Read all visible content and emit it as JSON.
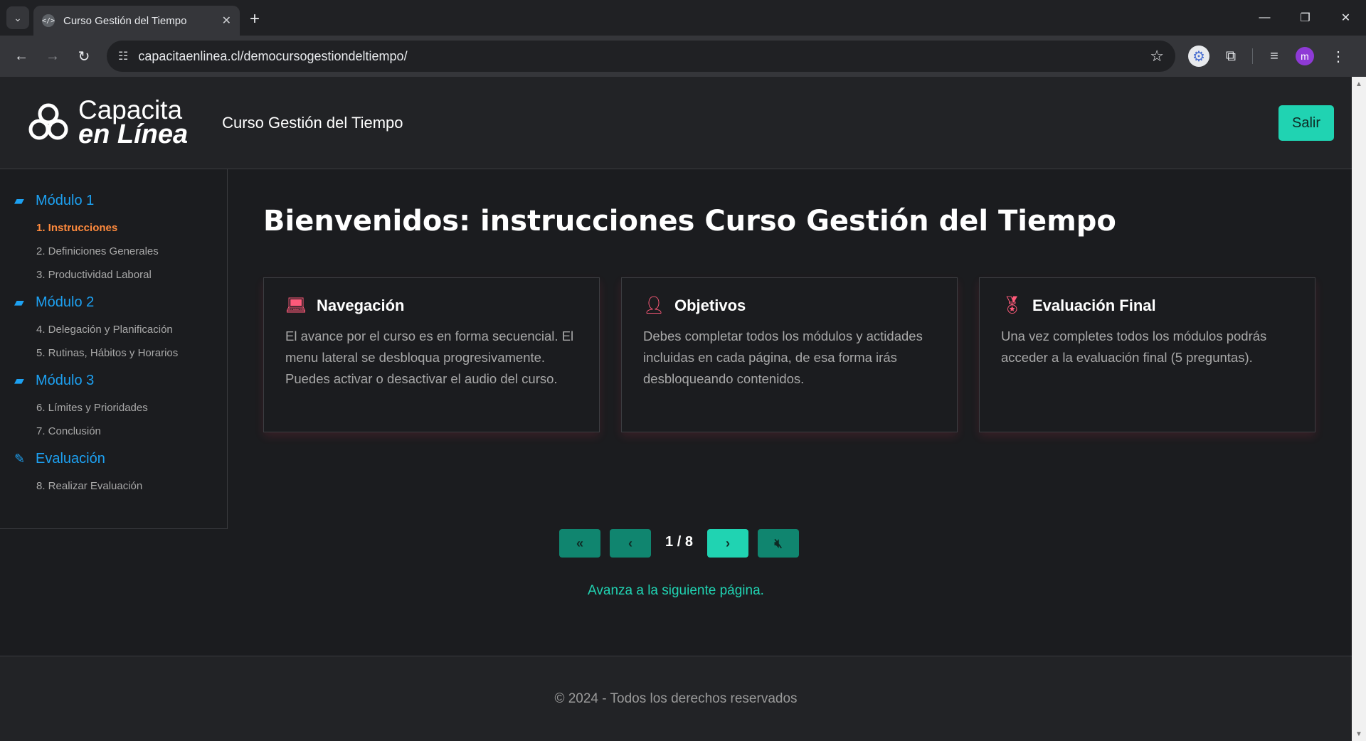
{
  "browser": {
    "tab_title": "Curso Gestión del Tiempo",
    "url": "capacitaenlinea.cl/democursogestiondeltiempo/",
    "profile_initial": "m"
  },
  "site": {
    "logo_line1": "Capacita",
    "logo_line2": "en Línea",
    "course_title": "Curso Gestión del Tiempo",
    "exit_label": "Salir"
  },
  "sidebar": {
    "modules": [
      {
        "label": "Módulo 1",
        "icon": "archive-icon",
        "lessons": [
          "1. Instrucciones",
          "2. Definiciones Generales",
          "3. Productividad Laboral"
        ]
      },
      {
        "label": "Módulo 2",
        "icon": "archive-icon",
        "lessons": [
          "4. Delegación y Planificación",
          "5. Rutinas, Hábitos y Horarios"
        ]
      },
      {
        "label": "Módulo 3",
        "icon": "archive-icon",
        "lessons": [
          "6. Límites y Prioridades",
          "7. Conclusión"
        ]
      },
      {
        "label": "Evaluación",
        "icon": "pen-icon",
        "lessons": [
          "8. Realizar Evaluación"
        ]
      }
    ],
    "active_lesson": "1. Instrucciones"
  },
  "main": {
    "heading": "Bienvenidos: instrucciones Curso Gestión del Tiempo",
    "cards": [
      {
        "title": "Navegación",
        "icon": "laptop-code-icon",
        "text": "El avance por el curso es en forma secuencial. El menu lateral se desbloqua progresivamente. Puedes activar o desactivar el audio del curso."
      },
      {
        "title": "Objetivos",
        "icon": "teacher-icon",
        "text": "Debes completar todos los módulos y actidades incluidas en cada página, de esa forma irás desbloqueando contenidos."
      },
      {
        "title": "Evaluación Final",
        "icon": "award-icon",
        "text": "Una vez completes todos los módulos podrás acceder a la evaluación final (5 preguntas)."
      }
    ]
  },
  "pager": {
    "current": 1,
    "total": 8,
    "indicator": "1 / 8",
    "hint": "Avanza a la siguiente página."
  },
  "footer": {
    "text": "© 2024 - Todos los derechos reservados"
  },
  "colors": {
    "accent": "#20d3b2",
    "accent_dark": "#10856f",
    "link_blue": "#1da1f2",
    "active_orange": "#ff8a3d",
    "icon_pink": "#ff5a7a"
  }
}
